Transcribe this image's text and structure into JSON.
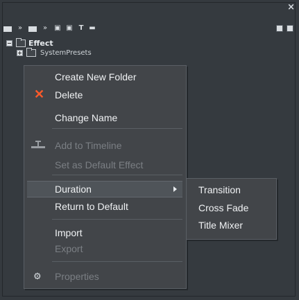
{
  "panel": {
    "close_glyph": "×"
  },
  "toolbar": {
    "icons": [
      "list-view-icon",
      "next-icon",
      "list-view-icon",
      "next-icon",
      "fit-icon",
      "fit-icon",
      "text-icon",
      "monitor-icon"
    ],
    "text_glyph": "T"
  },
  "tree": {
    "root_label": "Effect",
    "child_label": "SystemPresets"
  },
  "context_menu": {
    "create_new_folder": "Create New Folder",
    "delete": "Delete",
    "change_name": "Change Name",
    "add_to_timeline": "Add to Timeline",
    "set_as_default_effect": "Set as Default Effect",
    "duration": "Duration",
    "return_to_default": "Return to Default",
    "import": "Import",
    "export": "Export",
    "properties": "Properties"
  },
  "submenu": {
    "transition": "Transition",
    "cross_fade": "Cross Fade",
    "title_mixer": "Title Mixer"
  },
  "colors": {
    "panel_bg": "#353a3f",
    "menu_bg": "#424549",
    "delete_icon": "#ff5a2a",
    "disabled_text": "#7b7f84"
  }
}
